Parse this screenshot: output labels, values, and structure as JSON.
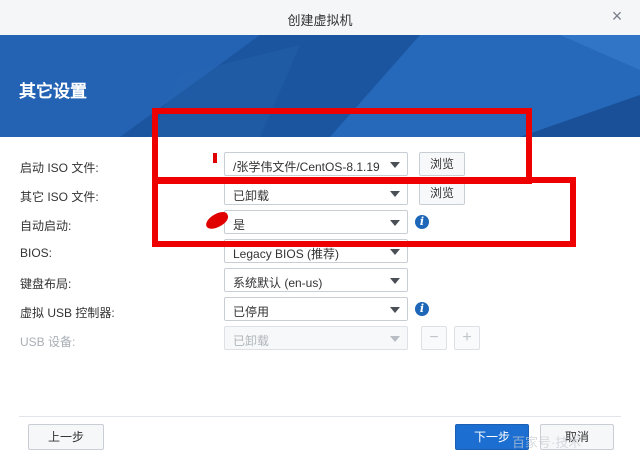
{
  "window": {
    "title": "创建虚拟机"
  },
  "header": {
    "title": "其它设置"
  },
  "form": {
    "boot_iso": {
      "label": "启动 ISO 文件:",
      "value": "/张学伟文件/CentOS-8.1.19",
      "browse": "浏览"
    },
    "other_iso": {
      "label": "其它 ISO 文件:",
      "value": "已卸载",
      "browse": "浏览"
    },
    "autostart": {
      "label": "自动启动:",
      "value": "是"
    },
    "bios": {
      "label": "BIOS:",
      "value": "Legacy BIOS (推荐)"
    },
    "keyboard": {
      "label": "键盘布局:",
      "value": "系统默认 (en-us)"
    },
    "usb_ctrl": {
      "label": "虚拟 USB 控制器:",
      "value": "已停用"
    },
    "usb_device": {
      "label": "USB 设备:",
      "value": "已卸载",
      "minus": "−",
      "plus": "+"
    }
  },
  "footer": {
    "prev": "上一步",
    "next": "下一步",
    "cancel": "取消"
  },
  "icons": {
    "close": "close-icon",
    "info": "info-icon",
    "dropdown": "chevron-down-icon"
  },
  "watermark": "百家号·技术",
  "colors": {
    "accent": "#1c6fd1",
    "banner": "#1d5aa8",
    "annotation": "#ee0000"
  }
}
